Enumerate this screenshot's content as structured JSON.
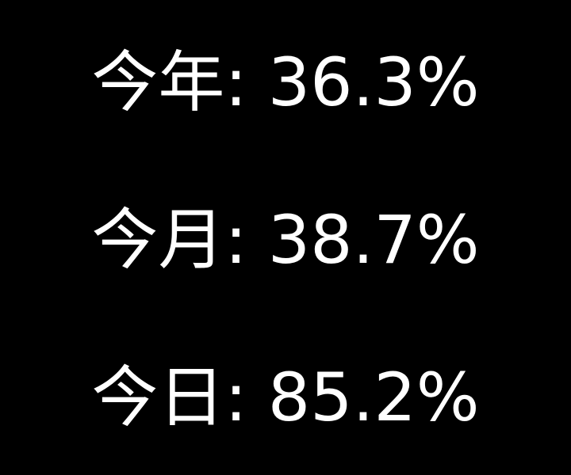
{
  "stats": [
    {
      "label": "今年",
      "separator": ":",
      "value": "36.3%"
    },
    {
      "label": "今月",
      "separator": ":",
      "value": "38.7%"
    },
    {
      "label": "今日",
      "separator": ":",
      "value": "85.2%"
    }
  ],
  "colors": {
    "background": "#000000",
    "text": "#ffffff"
  }
}
